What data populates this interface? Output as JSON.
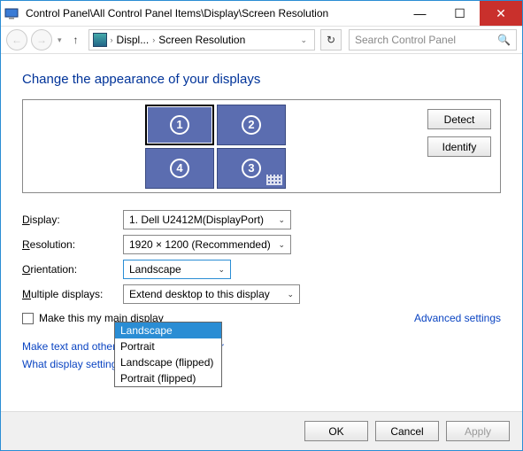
{
  "title": "Control Panel\\All Control Panel Items\\Display\\Screen Resolution",
  "nav": {
    "addr_seg1": "Displ...",
    "addr_seg2": "Screen Resolution",
    "search_placeholder": "Search Control Panel"
  },
  "heading": "Change the appearance of your displays",
  "side_buttons": {
    "detect": "Detect",
    "identify": "Identify"
  },
  "monitors": {
    "m1": "1",
    "m2": "2",
    "m3": "3",
    "m4": "4"
  },
  "labels": {
    "display_pre": "D",
    "display_post": "isplay:",
    "resolution_pre": "R",
    "resolution_post": "esolution:",
    "orientation_pre": "O",
    "orientation_post": "rientation:",
    "multiple_pre": "M",
    "multiple_post": "ultiple displays:"
  },
  "combos": {
    "display": "1. Dell U2412M(DisplayPort)",
    "resolution": "1920 × 1200 (Recommended)",
    "orientation": "Landscape",
    "multiple": "Extend desktop to this display"
  },
  "orientation_options": {
    "o1": "Landscape",
    "o2": "Portrait",
    "o3": "Landscape (flipped)",
    "o4": "Portrait (flipped)"
  },
  "checkbox_label": "Make this my main display",
  "adv_link": "Advanced settings",
  "link1": "Make text and other items larger or smaller",
  "link2": "What display settings should I choose?",
  "footer": {
    "ok": "OK",
    "cancel": "Cancel",
    "apply": "Apply"
  }
}
